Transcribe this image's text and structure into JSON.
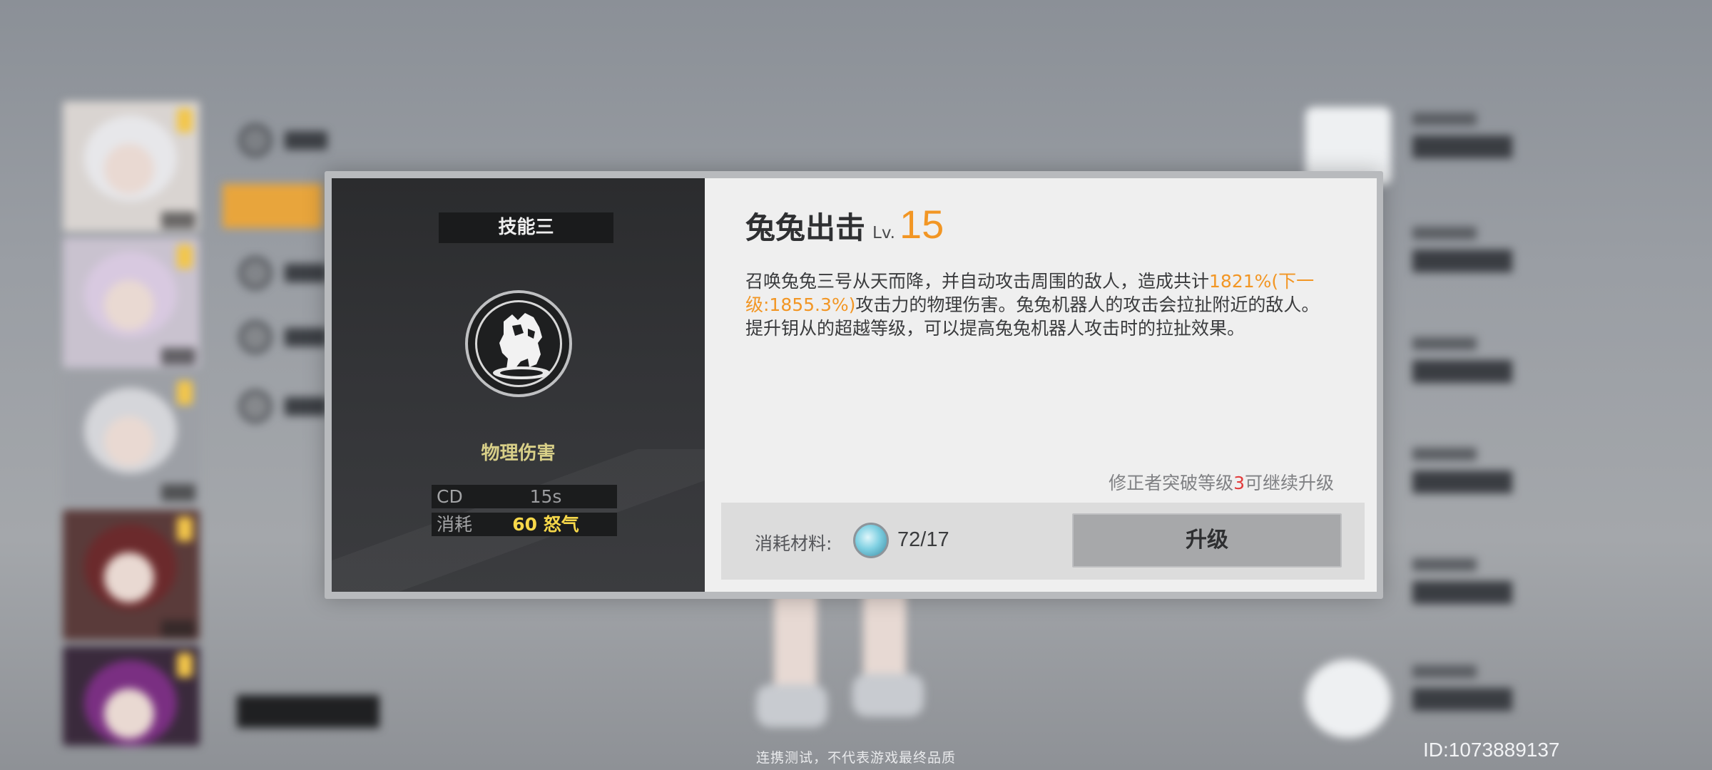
{
  "dialog": {
    "skill_slot_label": "技能三",
    "skill_icon": "robot-rabbit-icon",
    "damage_type": "物理伤害",
    "stats": [
      {
        "key": "CD",
        "value": "15s",
        "color": "#9c9da0"
      },
      {
        "key": "消耗",
        "value": "60 怒气",
        "color": "#f7d84a"
      }
    ],
    "skill_name": "兔兔出击",
    "level_label": "Lv.",
    "level_value": "15",
    "description": {
      "part1": "召唤兔兔三号从天而降，并自动攻击周围的敌人，造成共计",
      "highlight": "1821%(下一级:1855.3%)",
      "part2": "攻击力的物理伤害。兔兔机器人的攻击会拉扯附近的敌人。",
      "line2": "提升钥从的超越等级，可以提高兔兔机器人攻击时的拉扯效果。"
    },
    "upgrade_note": {
      "prefix": "修正者突破等级",
      "level": "3",
      "suffix": "可继续升级"
    },
    "cost": {
      "label": "消耗材料:",
      "material_icon": "crystal-icon",
      "value": "72/17"
    },
    "upgrade_button": "升级"
  },
  "footer": {
    "watermark": "连携测试，不代表游戏最终品质",
    "uid": "ID:1073889137"
  },
  "colors": {
    "accent_orange": "#f29624",
    "highlight_red": "#e23b3b",
    "damage_type_yellow": "#d8cf88"
  }
}
